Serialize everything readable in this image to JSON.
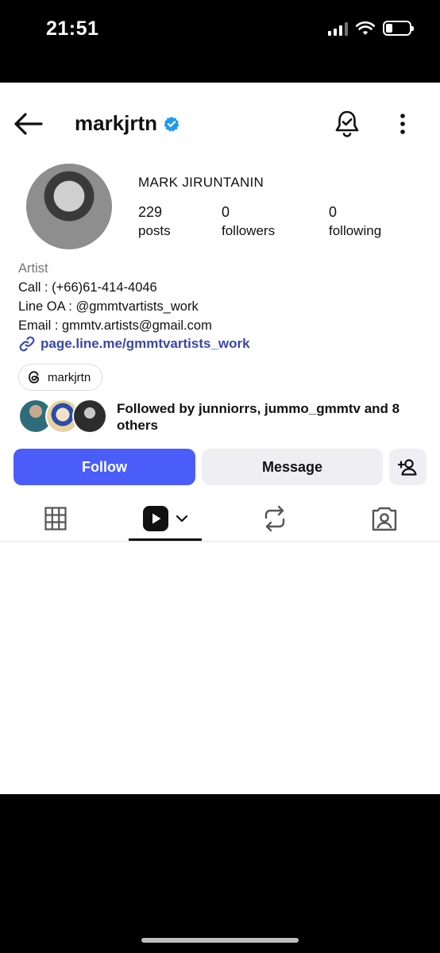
{
  "status": {
    "time": "21:51"
  },
  "header": {
    "username": "markjrtn"
  },
  "profile": {
    "full_name": "MARK JIRUNTANIN",
    "stats": [
      {
        "value": "229",
        "label": "posts"
      },
      {
        "value": "0",
        "label": "followers"
      },
      {
        "value": "0",
        "label": "following"
      }
    ],
    "bio": {
      "category": "Artist",
      "lines": [
        "Call : (+66)61-414-4046",
        "Line OA : @gmmtvartists_work",
        "Email : gmmtv.artists@gmail.com"
      ]
    },
    "link": "page.line.me/gmmtvartists_work",
    "threads_handle": "markjrtn",
    "followed_by": "Followed by junniorrs, jummo_gmmtv and 8 others"
  },
  "actions": {
    "follow": "Follow",
    "message": "Message"
  },
  "tabs": [
    {
      "icon": "grid-icon",
      "active": false
    },
    {
      "icon": "reels-icon",
      "active": true
    },
    {
      "icon": "reposts-icon",
      "active": false
    },
    {
      "icon": "tagged-icon",
      "active": false
    }
  ],
  "colors": {
    "accent": "#4a5df9",
    "link": "#3848a8",
    "verified": "#1d9bf0"
  }
}
